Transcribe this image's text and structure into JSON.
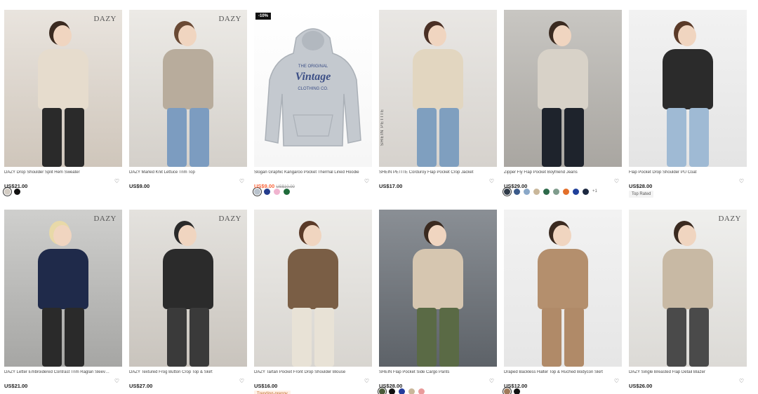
{
  "products": [
    {
      "title": "DAZY Drop Shoulder Split Hem Sweater",
      "price": "US$21.00",
      "old_price": "",
      "brand": "DAZY",
      "badge": "",
      "tag": "",
      "swatches": [
        "#d3ccc3",
        "#111111"
      ],
      "more": "",
      "bg": [
        "#e9e4de",
        "#cfc6bb"
      ],
      "top": "#e6dccd",
      "bottom": "#2a2a2a",
      "hair": "#3a2a20"
    },
    {
      "title": "DAZY Marled Knit Lettuce Trim Top",
      "price": "US$9.00",
      "old_price": "",
      "brand": "DAZY",
      "badge": "",
      "tag": "",
      "swatches": [],
      "more": "",
      "bg": [
        "#eceae6",
        "#d4d0ca"
      ],
      "top": "#b8ac9c",
      "bottom": "#7c9cc0",
      "hair": "#6a4a35"
    },
    {
      "title": "Slogan Graphic Kangaroo Pocket Thermal Lined Hoodie",
      "price": "US$9.00",
      "old_price": "US$10.00",
      "brand": "",
      "badge": "-10%",
      "tag": "",
      "swatches": [
        "#b9c2cc",
        "#243c8c",
        "#f0b4cf",
        "#1f6b3a"
      ],
      "more": "",
      "bg": [
        "#ffffff",
        "#f6f6f6"
      ],
      "top": "#c4c9cf",
      "bottom": "",
      "hair": ""
    },
    {
      "title": "SHEIN PETITE Corduroy Flap Pocket Crop Jacket",
      "price": "US$17.00",
      "old_price": "",
      "brand": "",
      "side_brand": "SHEIN PETITE",
      "badge": "",
      "tag": "",
      "swatches": [],
      "more": "",
      "bg": [
        "#e9e7e4",
        "#d6d2cd"
      ],
      "top": "#e2d6c0",
      "bottom": "#7f9fbf",
      "hair": "#4a3025"
    },
    {
      "title": "Zipper Fly Flap Pocket Boyfriend Jeans",
      "price": "US$29.00",
      "old_price": "",
      "brand": "",
      "badge": "",
      "tag": "",
      "swatches": [
        "#2f3a48",
        "#3b5a8a",
        "#8aa8c8",
        "#c9b79a",
        "#2d6a4a",
        "#7f9c8c",
        "#e36f2a",
        "#1f3f9a",
        "#1c2840"
      ],
      "more": "+1",
      "bg": [
        "#c8c6c2",
        "#a9a6a1"
      ],
      "top": "#d8d2c8",
      "bottom": "#1e232c",
      "hair": "#3a2a20"
    },
    {
      "title": "Flap Pocket Drop Shoulder PU Coat",
      "price": "US$28.00",
      "old_price": "",
      "brand": "",
      "badge": "",
      "tag": "Top Rated",
      "tag_style": "gray",
      "swatches": [],
      "more": "",
      "bg": [
        "#f2f2f2",
        "#e4e4e4"
      ],
      "top": "#2b2b2b",
      "bottom": "#9fbad4",
      "hair": "#5a3a28"
    },
    {
      "title": "DAZY Letter Embroidered Contrast Trim Raglan Sleeve Cardigan",
      "price": "US$21.00",
      "old_price": "",
      "brand": "DAZY",
      "badge": "",
      "tag": "",
      "swatches": [],
      "more": "",
      "bg": [
        "#cfcfcd",
        "#a6a6a4"
      ],
      "top": "#1f2a4a",
      "bottom": "#2a2a2a",
      "hair": "#e8d9a8"
    },
    {
      "title": "DAZY Textured Frog Button Crop Top & Skirt",
      "price": "US$27.00",
      "old_price": "",
      "brand": "DAZY",
      "badge": "",
      "tag": "",
      "swatches": [],
      "more": "",
      "bg": [
        "#e4e2de",
        "#c9c4bd"
      ],
      "top": "#2b2b2b",
      "bottom": "#3a3a3a",
      "hair": "#2a2a2a"
    },
    {
      "title": "DAZY Tartan Pocket Front Drop Shoulder Blouse",
      "price": "US$16.00",
      "old_price": "",
      "brand": "",
      "badge": "",
      "tag": "Trending-preppy",
      "tag_style": "orange",
      "swatches": [],
      "more": "",
      "bg": [
        "#ecebe8",
        "#d8d5d0"
      ],
      "top": "#7a5e45",
      "bottom": "#e8e2d6",
      "hair": "#5a3a28"
    },
    {
      "title": "SHEIN Flap Pocket Side Cargo Pants",
      "price": "US$28.00",
      "old_price": "",
      "brand": "",
      "badge": "",
      "tag": "",
      "swatches": [
        "#4a5a3a",
        "#111111",
        "#243c9c",
        "#c9b79a",
        "#e99b9b"
      ],
      "more": "",
      "bg": [
        "#8a8f95",
        "#5d6268"
      ],
      "top": "#d6c6b0",
      "bottom": "#5a6a45",
      "hair": "#3a2a20"
    },
    {
      "title": "Draped Backless Halter Top & Ruched Bodycon Skirt",
      "price": "US$12.00",
      "old_price": "",
      "brand": "",
      "badge": "",
      "tag": "",
      "swatches": [
        "#a07a5a",
        "#111111"
      ],
      "more": "",
      "bg": [
        "#f2f2f2",
        "#e6e6e6"
      ],
      "top": "#b48f6d",
      "bottom": "#b08a68",
      "hair": "#3a2a20"
    },
    {
      "title": "DAZY Single Breasted Flap Detail Blazer",
      "price": "US$26.00",
      "old_price": "",
      "brand": "DAZY",
      "badge": "",
      "tag": "",
      "swatches": [],
      "more": "",
      "bg": [
        "#efefed",
        "#dcdad6"
      ],
      "top": "#c8b9a4",
      "bottom": "#4a4a4a",
      "hair": "#3a2a20"
    }
  ]
}
